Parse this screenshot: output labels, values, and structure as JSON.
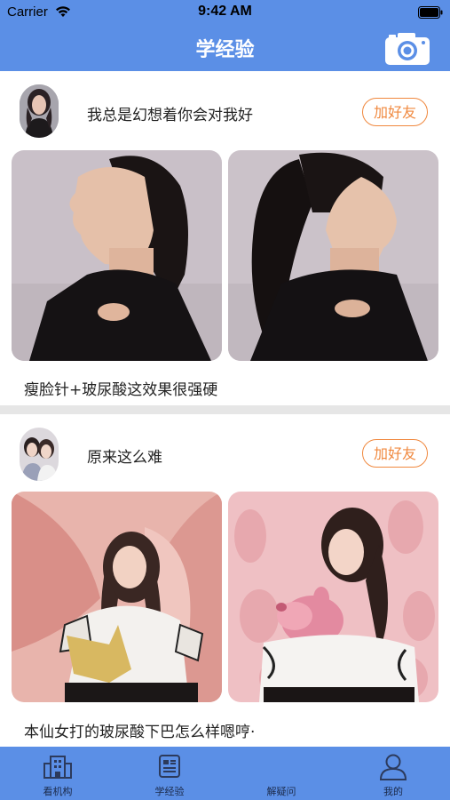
{
  "status_bar": {
    "carrier": "Carrier",
    "time": "9:42 AM",
    "wifi_icon": "wifi-icon",
    "battery_icon": "battery-icon"
  },
  "nav_bar": {
    "title": "学经验",
    "camera_icon": "camera-icon",
    "color": "#5b8fe6"
  },
  "posts": [
    {
      "username": "我总是幻想着你会对我好",
      "add_friend_label": "加好友",
      "caption": "瘦脸针+玻尿酸这效果很强硬"
    },
    {
      "username": "原来这么难",
      "add_friend_label": "加好友",
      "caption": "本仙女打的玻尿酸下巴怎么样嗯哼·"
    }
  ],
  "tabs": [
    {
      "label": "看机构",
      "icon": "building-icon"
    },
    {
      "label": "学经验",
      "icon": "notebook-icon"
    },
    {
      "label": "解疑问",
      "icon": "question-icon"
    },
    {
      "label": "我的",
      "icon": "person-icon"
    }
  ],
  "colors": {
    "primary": "#5b8fe6",
    "accent": "#f0883e",
    "divider": "#e6e6e6"
  }
}
